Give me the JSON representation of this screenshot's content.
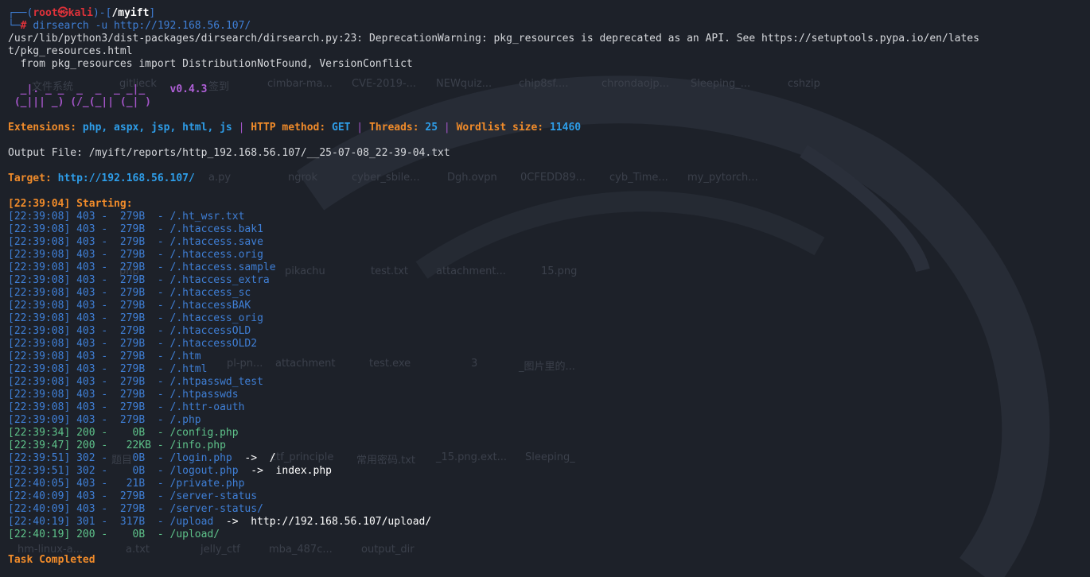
{
  "prompt": {
    "user": "root",
    "host": "kali",
    "cwd": "/myift",
    "command": "dirsearch -u http://192.168.56.107/"
  },
  "warning": {
    "line1": "/usr/lib/python3/dist-packages/dirsearch/dirsearch.py:23: DeprecationWarning: pkg_resources is deprecated as an API. See https://setuptools.pypa.io/en/lates",
    "line2": "t/pkg_resources.html",
    "line3": "  from pkg_resources import DistributionNotFound, VersionConflict"
  },
  "logo": {
    "line1": "  _|. _ _  _  _  _ _|_    ",
    "version": "v0.4.3",
    "line2": " (_||| _) (/_(_|| (_| )"
  },
  "config": {
    "extensions_label": "Extensions: ",
    "extensions": "php, aspx, jsp, html, js",
    "method_label": "HTTP method: ",
    "method": "GET",
    "threads_label": "Threads: ",
    "threads": "25",
    "wordlist_label": "Wordlist size: ",
    "wordlist": "11460",
    "sep": " | "
  },
  "output_file": "Output File: /myift/reports/http_192.168.56.107/__25-07-08_22-39-04.txt",
  "target": {
    "label": "Target: ",
    "url": "http://192.168.56.107/"
  },
  "starting": "[22:39:04] Starting: ",
  "results": [
    {
      "text": "[22:39:08] 403 -  279B  - /.ht_wsr.txt",
      "color": "#3f7fd6"
    },
    {
      "text": "[22:39:08] 403 -  279B  - /.htaccess.bak1",
      "color": "#3f7fd6"
    },
    {
      "text": "[22:39:08] 403 -  279B  - /.htaccess.save",
      "color": "#3f7fd6"
    },
    {
      "text": "[22:39:08] 403 -  279B  - /.htaccess.orig",
      "color": "#3f7fd6"
    },
    {
      "text": "[22:39:08] 403 -  279B  - /.htaccess.sample",
      "color": "#3f7fd6"
    },
    {
      "text": "[22:39:08] 403 -  279B  - /.htaccess_extra",
      "color": "#3f7fd6"
    },
    {
      "text": "[22:39:08] 403 -  279B  - /.htaccess_sc",
      "color": "#3f7fd6"
    },
    {
      "text": "[22:39:08] 403 -  279B  - /.htaccessBAK",
      "color": "#3f7fd6"
    },
    {
      "text": "[22:39:08] 403 -  279B  - /.htaccess_orig",
      "color": "#3f7fd6"
    },
    {
      "text": "[22:39:08] 403 -  279B  - /.htaccessOLD",
      "color": "#3f7fd6"
    },
    {
      "text": "[22:39:08] 403 -  279B  - /.htaccessOLD2",
      "color": "#3f7fd6"
    },
    {
      "text": "[22:39:08] 403 -  279B  - /.htm",
      "color": "#3f7fd6"
    },
    {
      "text": "[22:39:08] 403 -  279B  - /.html",
      "color": "#3f7fd6"
    },
    {
      "text": "[22:39:08] 403 -  279B  - /.htpasswd_test",
      "color": "#3f7fd6"
    },
    {
      "text": "[22:39:08] 403 -  279B  - /.htpasswds",
      "color": "#3f7fd6"
    },
    {
      "text": "[22:39:08] 403 -  279B  - /.httr-oauth",
      "color": "#3f7fd6"
    },
    {
      "text": "[22:39:09] 403 -  279B  - /.php",
      "color": "#3f7fd6"
    },
    {
      "text": "[22:39:34] 200 -    0B  - /config.php",
      "color": "#5ec28a"
    },
    {
      "text": "[22:39:47] 200 -   22KB - /info.php",
      "color": "#5ec28a"
    },
    {
      "text": "[22:39:51] 302 -    0B  - /login.php",
      "color": "#3f7fd6",
      "redirect": "  ->  /"
    },
    {
      "text": "[22:39:51] 302 -    0B  - /logout.php",
      "color": "#3f7fd6",
      "redirect": "  ->  index.php"
    },
    {
      "text": "[22:40:05] 403 -   21B  - /private.php",
      "color": "#3f7fd6"
    },
    {
      "text": "[22:40:09] 403 -  279B  - /server-status",
      "color": "#3f7fd6"
    },
    {
      "text": "[22:40:09] 403 -  279B  - /server-status/",
      "color": "#3f7fd6"
    },
    {
      "text": "[22:40:19] 301 -  317B  - /upload",
      "color": "#3f7fd6",
      "redirect": "  ->  http://192.168.56.107/upload/"
    },
    {
      "text": "[22:40:19] 200 -    0B  - /upload/",
      "color": "#5ec28a"
    }
  ],
  "completed": "Task Completed",
  "desktop_icons": [
    "文件系统",
    "gitlieck",
    "签到",
    "cimbar-ma...",
    "CVE-2019-...",
    "NEWquiz...",
    "chip8sf....",
    "chrondaojp...",
    "Sleeping_...",
    "cshzip",
    "a.py",
    "ngrok",
    "cyber_sbile...",
    "Dgh.ovpn",
    "0CFEDD89...",
    "cyb_Time...",
    "my_pytorch...",
    "php_",
    "pikachu",
    "test.txt",
    "attachment...",
    "15.png",
    "pl-pn...",
    "attachment",
    "test.exe",
    "3",
    "_图片里的...",
    "题目",
    "ctf_principle",
    "常用密码.txt",
    "_15.png.ext...",
    "Sleeping_",
    "hm-linux-a...",
    "a.txt",
    "jelly_ctf",
    "mba_487c...",
    "output_dir"
  ]
}
